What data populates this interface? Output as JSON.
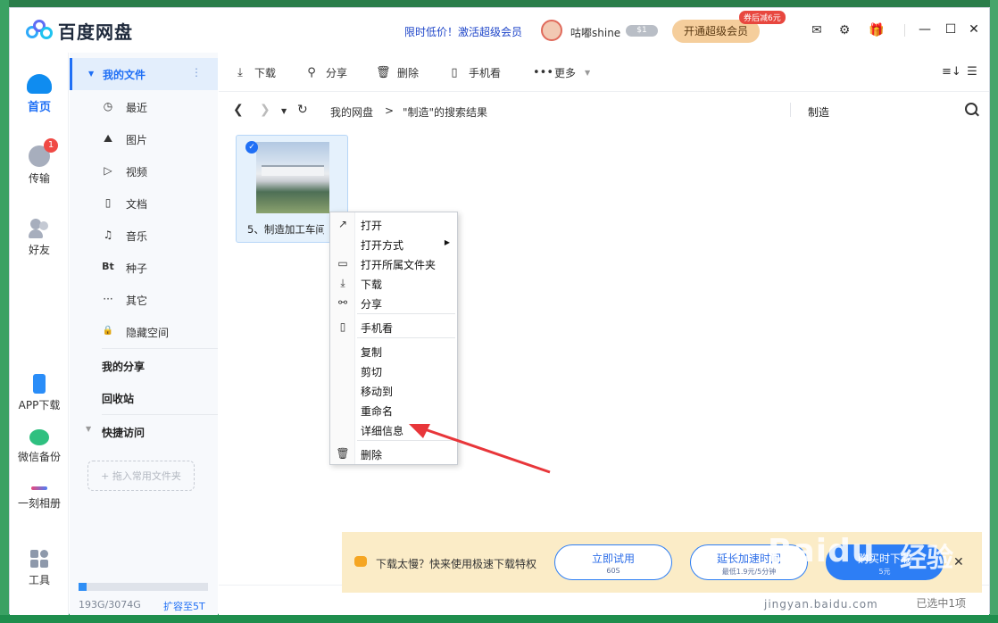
{
  "app": {
    "title": "百度网盘"
  },
  "header": {
    "promo": "限时低价！激活超级会员",
    "username": "咕嘟shine",
    "vip_level": "$1",
    "open_vip": "开通超级会员",
    "coupon": "券后减6元"
  },
  "nav": {
    "home": "首页",
    "transfer": "传输",
    "transfer_badge": "1",
    "friends": "好友",
    "app_download": "APP下载",
    "wechat_backup": "微信备份",
    "album": "一刻相册",
    "tools": "工具"
  },
  "sidebar": {
    "my_files": "我的文件",
    "items": [
      {
        "icon": "clock-icon",
        "glyph": "◷",
        "label": "最近"
      },
      {
        "icon": "image-icon",
        "glyph": "⛰",
        "label": "图片"
      },
      {
        "icon": "video-icon",
        "glyph": "▷",
        "label": "视频"
      },
      {
        "icon": "document-icon",
        "glyph": "▯",
        "label": "文档"
      },
      {
        "icon": "music-icon",
        "glyph": "♫",
        "label": "音乐"
      },
      {
        "icon": "torrent-icon",
        "glyph": "Bt",
        "label": "种子"
      },
      {
        "icon": "more-icon",
        "glyph": "···",
        "label": "其它"
      },
      {
        "icon": "lock-icon",
        "glyph": "🔒",
        "label": "隐藏空间"
      }
    ],
    "my_share": "我的分享",
    "recycle": "回收站",
    "quick_access": "快捷访问",
    "drag_hint": "+ 拖入常用文件夹",
    "quota": "193G/3074G",
    "quota_fraction": 0.063,
    "expand": "扩容至5T"
  },
  "toolbar": {
    "download": "下载",
    "share": "分享",
    "delete": "删除",
    "phone_view": "手机看",
    "more": "更多"
  },
  "breadcrumb": {
    "root": "我的网盘",
    "sep": ">",
    "current": "\"制造\"的搜索结果"
  },
  "search": {
    "value": "制造"
  },
  "file": {
    "name": "5、制造加工车间"
  },
  "context_menu": {
    "open": "打开",
    "open_with": "打开方式",
    "open_folder": "打开所属文件夹",
    "download": "下载",
    "share": "分享",
    "phone_view": "手机看",
    "copy": "复制",
    "cut": "剪切",
    "move_to": "移动到",
    "rename": "重命名",
    "details": "详细信息",
    "delete": "删除"
  },
  "banner": {
    "text": "下载太慢？快来使用极速下载特权",
    "try_main": "立即试用",
    "try_sub": "60S",
    "extend_main": "延长加速时间",
    "extend_sub": "最低1.9元/5分钟",
    "buy_main": "购买时下载",
    "buy_sub": "5元"
  },
  "status": {
    "selected": "已选中1项"
  },
  "watermark": {
    "brand": "Baidu",
    "suffix": "经验",
    "url": "jingyan.baidu.com"
  }
}
